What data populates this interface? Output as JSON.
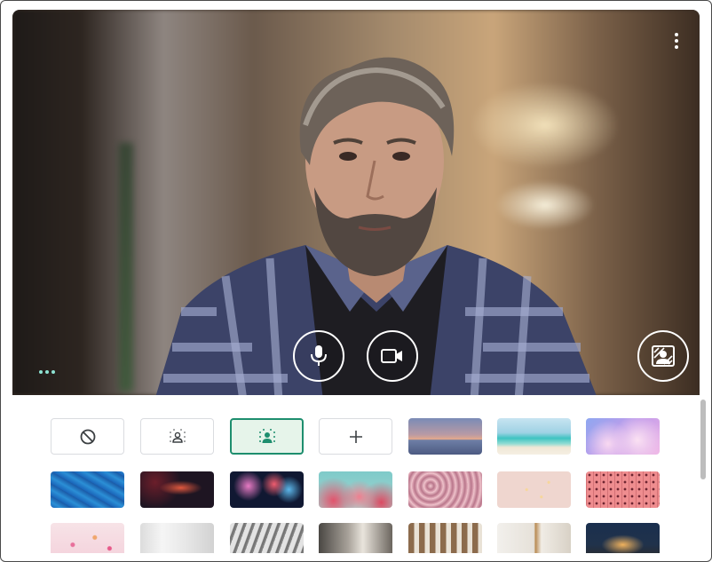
{
  "preview": {
    "more_options_icon": "more-vert-icon",
    "self_view_menu_icon": "more-horiz-icon",
    "accent_dots_color": "#8ee3d3"
  },
  "controls": {
    "mic_icon": "microphone-icon",
    "camera_icon": "video-camera-icon",
    "effects_icon": "background-effects-icon",
    "button_border_color": "#ffffff"
  },
  "effects_panel": {
    "selected_accent": "#1e8e6e",
    "options": [
      {
        "id": "no-effect",
        "icon": "block-icon"
      },
      {
        "id": "slight-blur",
        "icon": "blur-slight-icon"
      },
      {
        "id": "blur",
        "icon": "blur-icon",
        "selected": true
      },
      {
        "id": "upload",
        "icon": "plus-icon"
      }
    ],
    "backgrounds": [
      "sunset-horizon",
      "tropical-beach",
      "pink-clouds",
      "blue-water",
      "red-nebula",
      "fireworks",
      "pink-blossoms",
      "flower-field",
      "pink-confetti-wall",
      "pink-grid-pattern",
      "confetti-floor",
      "white-room",
      "skylight-room",
      "modern-interior",
      "bookshelf-room",
      "white-shelves",
      "lit-house-night"
    ]
  }
}
